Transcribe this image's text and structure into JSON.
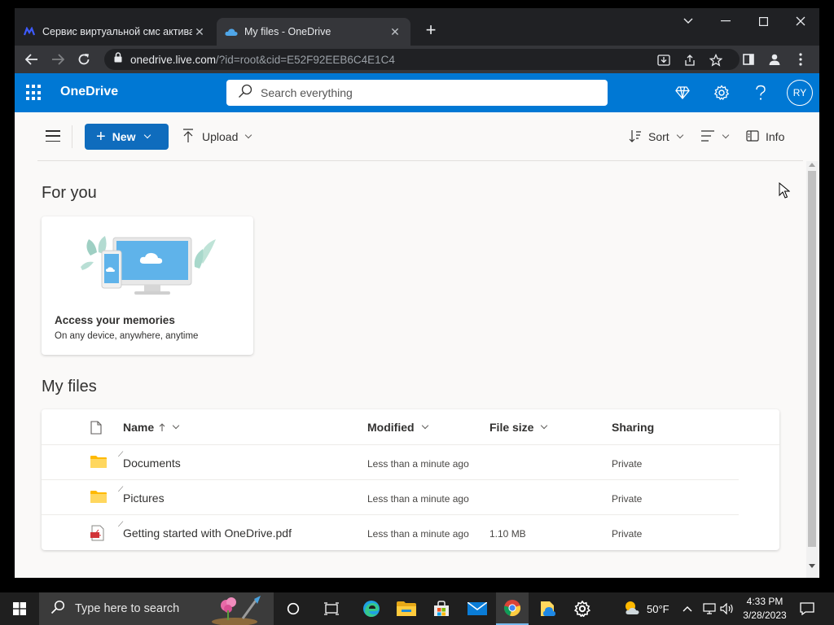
{
  "browser": {
    "tabs": [
      {
        "title": "Сервис виртуальной смс актива",
        "close": "✕"
      },
      {
        "title": "My files - OneDrive",
        "close": "✕"
      }
    ],
    "new_tab": "+",
    "url_host": "onedrive.live.com",
    "url_rest": "/?id=root&cid=E52F92EEB6C4E1C4"
  },
  "header": {
    "brand": "OneDrive",
    "search_placeholder": "Search everything",
    "avatar_initials": "RY"
  },
  "commands": {
    "new_label": "New",
    "upload_label": "Upload",
    "sort_label": "Sort",
    "info_label": "Info"
  },
  "for_you": {
    "title": "For you",
    "card_title": "Access your memories",
    "card_subtitle": "On any device, anywhere, anytime"
  },
  "my_files": {
    "title": "My files",
    "columns": {
      "name": "Name",
      "modified": "Modified",
      "size": "File size",
      "sharing": "Sharing"
    },
    "rows": [
      {
        "name": "Documents",
        "modified": "Less than a minute ago",
        "size": "",
        "sharing": "Private",
        "icon": "folder-icon"
      },
      {
        "name": "Pictures",
        "modified": "Less than a minute ago",
        "size": "",
        "sharing": "Private",
        "icon": "folder-icon"
      },
      {
        "name": "Getting started with OneDrive.pdf",
        "modified": "Less than a minute ago",
        "size": "1.10 MB",
        "sharing": "Private",
        "icon": "pdf-file-icon"
      }
    ]
  },
  "taskbar": {
    "search_text": "Type here to search",
    "weather": "50°F",
    "time": "4:33 PM",
    "date": "3/28/2023"
  },
  "colors": {
    "onedrive_blue": "#0078d4",
    "primary_button": "#0f6cbd",
    "chrome_dark": "#202124",
    "folder_yellow": "#ffcb3d"
  }
}
